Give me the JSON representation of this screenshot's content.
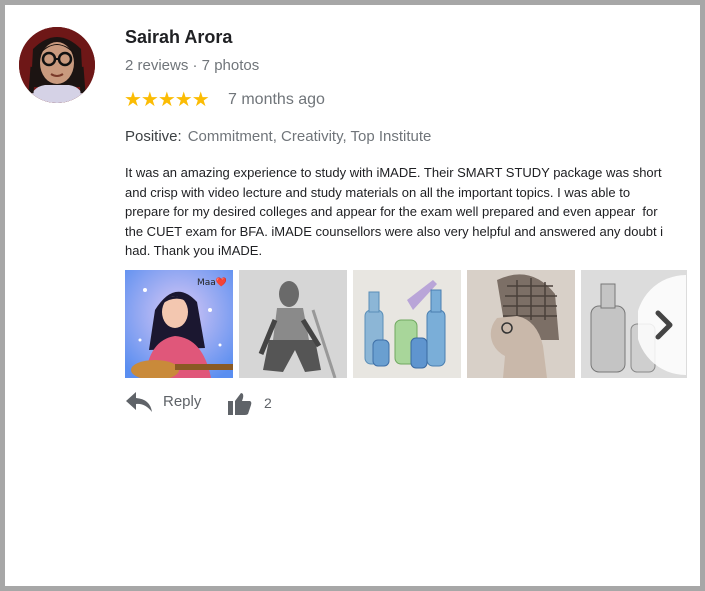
{
  "reviewer": {
    "name": "Sairah Arora",
    "meta": "2 reviews · 7 photos"
  },
  "rating": {
    "stars": 5,
    "stars_text": "★★★★★",
    "time": "7 months ago"
  },
  "positive": {
    "label": "Positive:",
    "values": "Commitment, Creativity, Top Institute"
  },
  "review_text": "It was an amazing experience to study with iMADE. Their SMART STUDY package was short and crisp with video lecture and study materials on all the important topics. I was able to prepare for my desired colleges and appear for the exam well prepared and even appear  for the CUET exam for BFA. iMADE counsellors were also very helpful and answered any doubt i had. Thank you iMADE.",
  "photos": [
    {
      "name": "photo-girl-guitar",
      "caption": "Maa❤️"
    },
    {
      "name": "photo-man-sketch"
    },
    {
      "name": "photo-bottles-watercolor"
    },
    {
      "name": "photo-woman-profile-sketch"
    },
    {
      "name": "photo-glass-bottles-sketch"
    }
  ],
  "actions": {
    "reply_label": "Reply",
    "like_count": "2"
  },
  "icons": {
    "reply": "reply-icon",
    "like": "thumbs-up-icon",
    "next": "chevron-right-icon"
  },
  "colors": {
    "star": "#fbbc04",
    "muted": "#70757a"
  }
}
